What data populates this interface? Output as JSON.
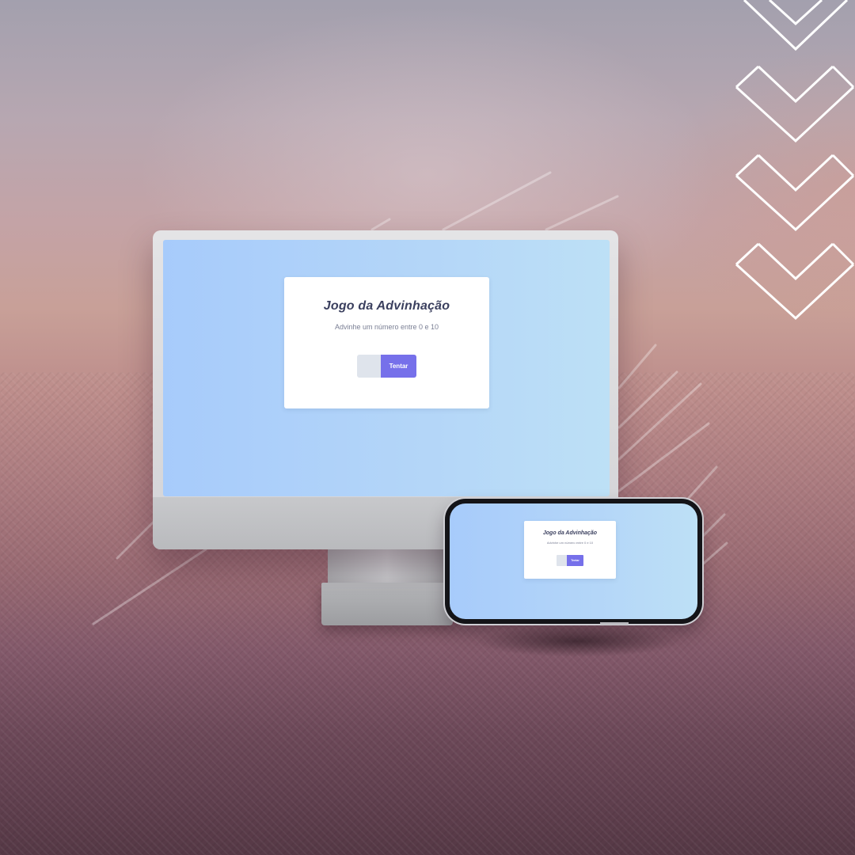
{
  "desktop": {
    "title": "Jogo da Advinhação",
    "subtitle": "Advinhe um número entre 0 e 10",
    "input_value": "",
    "button_label": "Tentar"
  },
  "mobile": {
    "title": "Jogo da Advinhação",
    "subtitle": "Advinhe um número entre 0 e 10",
    "input_value": "",
    "button_label": "Tentar"
  },
  "colors": {
    "accent_button": "#7670ea",
    "screen_gradient_start": "#a7cbfb",
    "screen_gradient_end": "#bde0f6",
    "card": "#ffffff",
    "title_text": "#3a3f5e"
  },
  "decorations": {
    "chevrons": [
      "chevron-down-icon",
      "chevron-down-icon",
      "chevron-down-icon",
      "chevron-down-icon"
    ]
  }
}
